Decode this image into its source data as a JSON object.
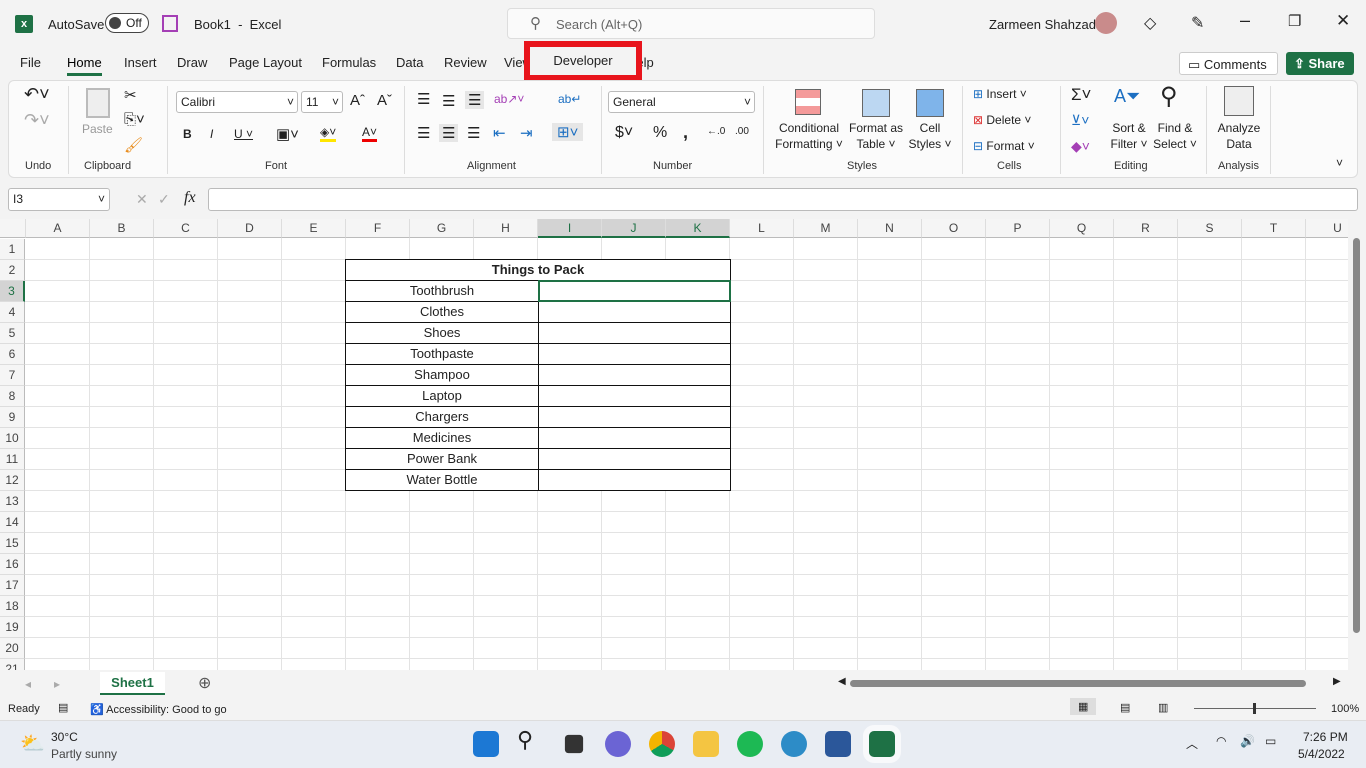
{
  "title_bar": {
    "autosave_label": "AutoSave",
    "autosave_state": "Off",
    "doc_title": "Book1  -  Excel",
    "search_placeholder": "Search (Alt+Q)",
    "user_name": "Zarmeen Shahzad"
  },
  "tabs": [
    "File",
    "Home",
    "Insert",
    "Draw",
    "Page Layout",
    "Formulas",
    "Data",
    "Review",
    "View",
    "Developer",
    "Help"
  ],
  "active_tab": "Home",
  "highlighted_tab": "Developer",
  "highlight_color": "#e8141c",
  "comments_label": "Comments",
  "share_label": "Share",
  "share_color": "#1e7145",
  "ribbon": {
    "groups": [
      "Undo",
      "Clipboard",
      "Font",
      "Alignment",
      "Number",
      "Styles",
      "Cells",
      "Editing",
      "Analysis"
    ],
    "paste": "Paste",
    "font_name": "Calibri",
    "font_size": "11",
    "number_format": "General",
    "conditional": [
      "Conditional",
      "Formatting ˅"
    ],
    "format_table": [
      "Format as",
      "Table ˅"
    ],
    "cell_styles": [
      "Cell",
      "Styles ˅"
    ],
    "insert": "Insert",
    "delete": "Delete",
    "format": "Format",
    "sort": [
      "Sort &",
      "Filter ˅"
    ],
    "find": [
      "Find &",
      "Select ˅"
    ],
    "analyze": [
      "Analyze",
      "Data"
    ]
  },
  "formula_bar": {
    "name_box": "I3",
    "value": ""
  },
  "columns": [
    "A",
    "B",
    "C",
    "D",
    "E",
    "F",
    "G",
    "H",
    "I",
    "J",
    "K",
    "L",
    "M",
    "N",
    "O",
    "P",
    "Q",
    "R",
    "S",
    "T",
    "U"
  ],
  "rows": [
    "1",
    "2",
    "3",
    "4",
    "5",
    "6",
    "7",
    "8",
    "9",
    "10",
    "11",
    "12",
    "13",
    "14",
    "15",
    "16",
    "17",
    "18",
    "19",
    "20",
    "21"
  ],
  "table": {
    "title": "Things to Pack",
    "items": [
      "Toothbrush",
      "Clothes",
      "Shoes",
      "Toothpaste",
      "Shampoo",
      "Laptop",
      "Chargers",
      "Medicines",
      "Power Bank",
      "Water Bottle"
    ]
  },
  "sheet_tab": "Sheet1",
  "status": {
    "ready": "Ready",
    "accessibility": "Accessibility: Good to go",
    "zoom": "100%"
  },
  "taskbar": {
    "temp": "30°C",
    "weather": "Partly sunny",
    "time": "7:26 PM",
    "date": "5/4/2022"
  }
}
